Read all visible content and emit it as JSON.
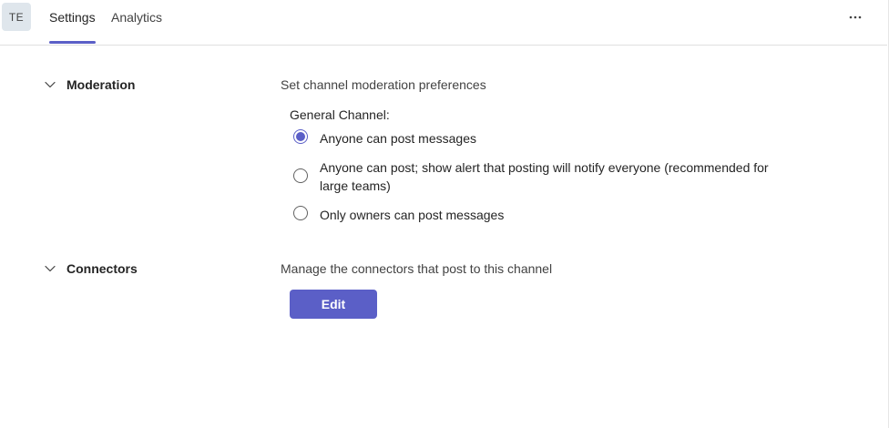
{
  "header": {
    "avatar_initials": "TE",
    "tabs": [
      {
        "label": "Settings",
        "active": true
      },
      {
        "label": "Analytics",
        "active": false
      }
    ],
    "more_icon": "more-horizontal-icon"
  },
  "sections": {
    "moderation": {
      "title": "Moderation",
      "description": "Set channel moderation preferences",
      "group_label": "General Channel:",
      "options": [
        {
          "label": "Anyone can post messages",
          "selected": true
        },
        {
          "label": "Anyone can post; show alert that posting will notify everyone (recommended for large teams)",
          "selected": false
        },
        {
          "label": "Only owners can post messages",
          "selected": false
        }
      ]
    },
    "connectors": {
      "title": "Connectors",
      "description": "Manage the connectors that post to this channel",
      "edit_label": "Edit"
    }
  },
  "colors": {
    "accent": "#5b5fc7",
    "avatar_bg": "#dfe6ec",
    "divider": "#e0e0e0"
  }
}
